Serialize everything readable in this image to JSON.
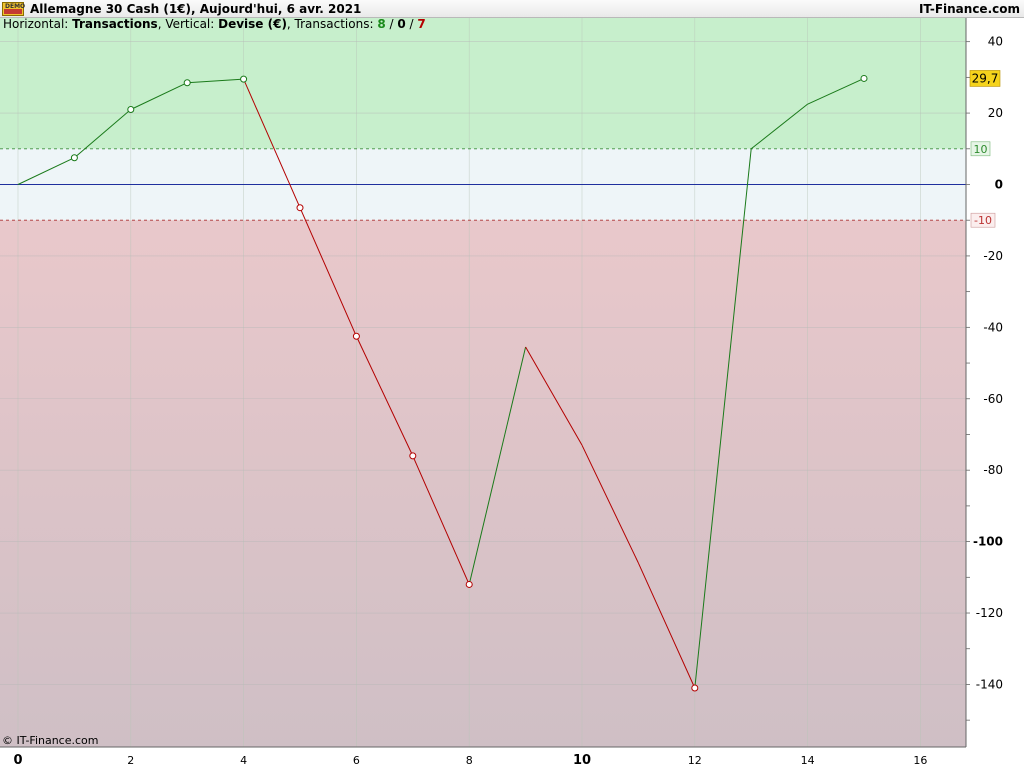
{
  "header": {
    "icon_label": "DEMO",
    "title": "Allemagne 30 Cash (1€), Aujourd'hui, 6 avr. 2021",
    "brand": "IT-Finance.com"
  },
  "subtitle": {
    "h_label": "Horizontal: ",
    "h_value": "Transactions",
    "v_label": ", Vertical: ",
    "v_value": "Devise (€)",
    "t_label": ", Transactions: ",
    "wins": "8",
    "sep1": " / ",
    "neutral": "0",
    "sep2": " / ",
    "losses": "7"
  },
  "footer": {
    "copyright": "© IT-Finance.com"
  },
  "colors": {
    "gain": "#1a7a1a",
    "loss": "#b30000",
    "zero_line": "#1f2f9e",
    "upper_zone": "#c7efcc",
    "mid_zone": "#eef5f8",
    "lower_zone_top": "#e9c8cb",
    "lower_zone_bottom": "#cfbfc5",
    "last_value_bg": "#f5d31c"
  },
  "chart_data": {
    "type": "line",
    "x": [
      0,
      1,
      2,
      3,
      4,
      5,
      6,
      7,
      8,
      9,
      10,
      11,
      12,
      13,
      14,
      15
    ],
    "y": [
      0,
      7.5,
      21,
      28.5,
      29.5,
      -6.5,
      -42.5,
      -76,
      -112,
      -45.5,
      -73,
      -106,
      -141,
      10,
      22.5,
      29.7
    ],
    "markers": [
      false,
      true,
      true,
      true,
      true,
      true,
      true,
      true,
      true,
      false,
      false,
      false,
      true,
      false,
      false,
      true
    ],
    "xlim": [
      0,
      17
    ],
    "ylim": [
      -157,
      44
    ],
    "x_ticks": [
      0,
      2,
      4,
      6,
      8,
      10,
      12,
      14,
      16
    ],
    "x_tick_labels": [
      "0",
      "2",
      "4",
      "6",
      "8",
      "10",
      "12",
      "14",
      "16"
    ],
    "x_bold_ticks": [
      "0",
      "10"
    ],
    "y_ticks": [
      40,
      20,
      0,
      -20,
      -40,
      -60,
      -80,
      -100,
      -120,
      -140
    ],
    "y_tick_labels": [
      "40",
      "20",
      "0",
      "-20",
      "-40",
      "-60",
      "-80",
      "-100",
      "-120",
      "-140"
    ],
    "y_bold_ticks": [
      "0",
      "-100"
    ],
    "zone_upper": 10,
    "zone_lower": -10,
    "zone_upper_label": "10",
    "zone_lower_label": "-10",
    "last_value_label": "29,7",
    "grid": true
  }
}
